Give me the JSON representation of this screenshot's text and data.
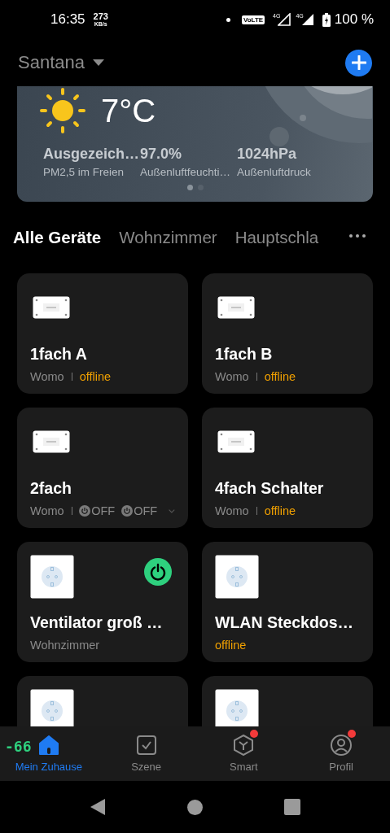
{
  "status_bar": {
    "time": "16:35",
    "speed": "273",
    "speed_unit": "KB/s",
    "volte": "VoLTE",
    "networks": [
      "4G",
      "4G"
    ],
    "battery": "100 %"
  },
  "header": {
    "home": "Santana"
  },
  "weather": {
    "temperature": "7°C",
    "stats": [
      {
        "value": "Ausgezeich…",
        "label": "PM2,5 im Freien"
      },
      {
        "value": "97.0%",
        "label": "Außenluftfeuchti…"
      },
      {
        "value": "1024hPa",
        "label": "Außenluftdruck"
      }
    ],
    "pages": [
      {
        "selected": true
      },
      {
        "selected": false
      }
    ]
  },
  "tabs": [
    {
      "label": "Alle Geräte",
      "selected": true
    },
    {
      "label": "Wohnzimmer",
      "selected": false
    },
    {
      "label": "Hauptschla",
      "selected": false
    }
  ],
  "devices": [
    {
      "kind": "switch",
      "name": "1fach A",
      "room": "Womo",
      "status": "offline"
    },
    {
      "kind": "switch",
      "name": "1fach B",
      "room": "Womo",
      "status": "offline"
    },
    {
      "kind": "switch",
      "name": "2fach",
      "room": "Womo",
      "channels": [
        {
          "label": "OFF"
        },
        {
          "label": "OFF"
        }
      ]
    },
    {
      "kind": "switch",
      "name": "4fach Schalter",
      "room": "Womo",
      "status": "offline"
    },
    {
      "kind": "socket",
      "name": "Ventilator groß …",
      "room": "Wohnzimmer",
      "power": true
    },
    {
      "kind": "socket",
      "name": "WLAN Steckdos…",
      "status": "offline"
    },
    {
      "kind": "socket"
    },
    {
      "kind": "socket"
    }
  ],
  "nav": [
    {
      "kind": "home",
      "label": "Mein Zuhause",
      "selected": true,
      "badge": false
    },
    {
      "kind": "scene",
      "label": "Szene",
      "selected": false,
      "badge": false
    },
    {
      "kind": "smart",
      "label": "Smart",
      "selected": false,
      "badge": true
    },
    {
      "kind": "profile",
      "label": "Profil",
      "selected": false,
      "badge": true
    }
  ],
  "overlay": "-66"
}
